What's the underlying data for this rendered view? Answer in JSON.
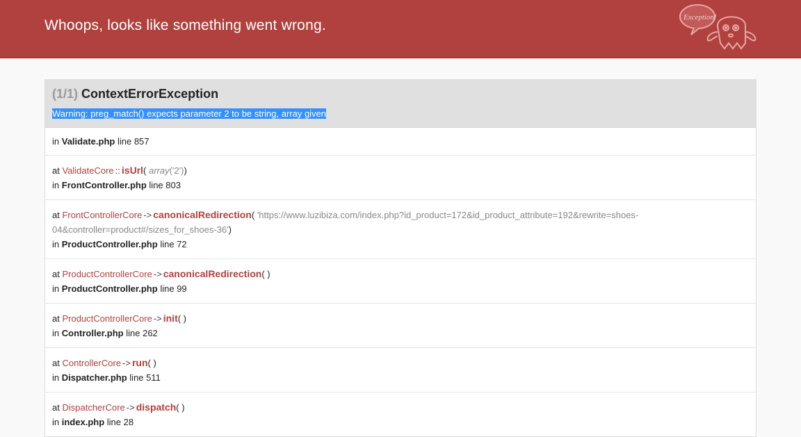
{
  "header": {
    "title": "Whoops, looks like something went wrong.",
    "logo_text": "Exception!"
  },
  "exception": {
    "count": "(1/1)",
    "name": "ContextErrorException",
    "message": "Warning: preg_match() expects parameter 2 to be string, array given"
  },
  "origin": {
    "in": "in",
    "file": "Validate.php",
    "line_label": "line",
    "line": "857"
  },
  "frames": [
    {
      "at": "at",
      "cls": "ValidateCore",
      "type": "::",
      "fn": "isUrl",
      "arg_kind": "array",
      "arg": "('2')",
      "in": "in",
      "file": "FrontController.php",
      "line_label": "line",
      "line": "803"
    },
    {
      "at": "at",
      "cls": "FrontControllerCore",
      "type": "->",
      "fn": "canonicalRedirection",
      "arg": "'https://www.luzibiza.com/index.php?id_product=172&id_product_attribute=192&rewrite=shoes-04&controller=product#/sizes_for_shoes-36'",
      "in": "in",
      "file": "ProductController.php",
      "line_label": "line",
      "line": "72"
    },
    {
      "at": "at",
      "cls": "ProductControllerCore",
      "type": "->",
      "fn": "canonicalRedirection",
      "in": "in",
      "file": "ProductController.php",
      "line_label": "line",
      "line": "99"
    },
    {
      "at": "at",
      "cls": "ProductControllerCore",
      "type": "->",
      "fn": "init",
      "in": "in",
      "file": "Controller.php",
      "line_label": "line",
      "line": "262"
    },
    {
      "at": "at",
      "cls": "ControllerCore",
      "type": "->",
      "fn": "run",
      "in": "in",
      "file": "Dispatcher.php",
      "line_label": "line",
      "line": "511"
    },
    {
      "at": "at",
      "cls": "DispatcherCore",
      "type": "->",
      "fn": "dispatch",
      "in": "in",
      "file": "index.php",
      "line_label": "line",
      "line": "28"
    }
  ],
  "colors": {
    "header_bg": "#b0413e",
    "accent": "#b0413e",
    "selection": "#3390ff"
  },
  "icons": {
    "logo": "ghost-exception-icon"
  }
}
